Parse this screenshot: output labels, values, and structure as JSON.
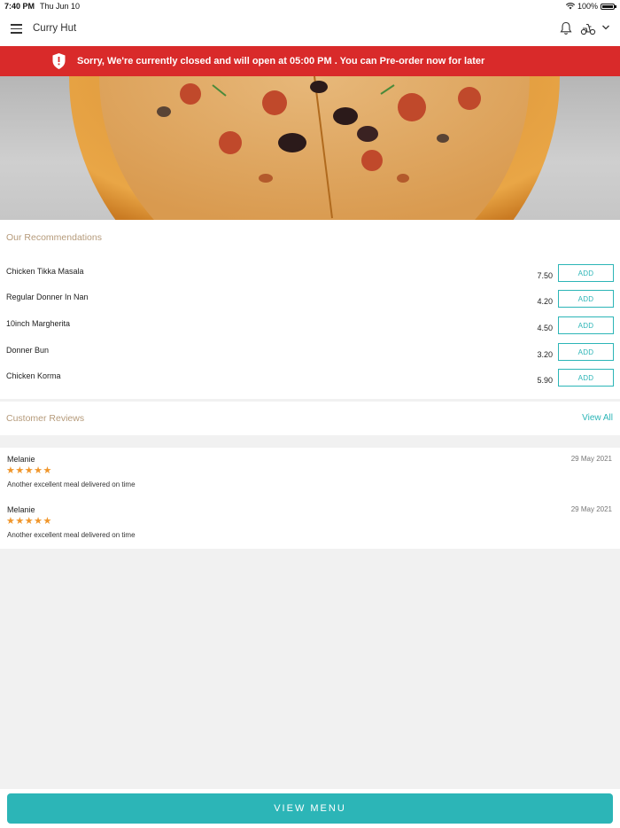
{
  "status_bar": {
    "time": "7:40 PM",
    "date": "Thu Jun 10",
    "battery": "100%"
  },
  "header": {
    "title": "Curry Hut"
  },
  "banner": {
    "text": "Sorry, We're currently closed and will open at 05:00 PM . You can Pre-order now for later"
  },
  "recommendations": {
    "title": "Our Recommendations",
    "add_label": "ADD",
    "items": [
      {
        "name": "Chicken Tikka Masala",
        "price": "7.50"
      },
      {
        "name": "Regular Donner In Nan",
        "price": "4.20"
      },
      {
        "name": "10inch Margherita",
        "price": "4.50"
      },
      {
        "name": "Donner Bun",
        "price": "3.20"
      },
      {
        "name": "Chicken Korma",
        "price": "5.90"
      }
    ]
  },
  "reviews": {
    "title": "Customer Reviews",
    "view_all": "View All",
    "items": [
      {
        "name": "Melanie",
        "date": "29 May 2021",
        "rating": 5,
        "stars": "★★★★★",
        "text": "Another excellent meal delivered on time"
      },
      {
        "name": "Melanie",
        "date": "29 May 2021",
        "rating": 5,
        "stars": "★★★★★",
        "text": "Another excellent meal delivered on time"
      }
    ]
  },
  "footer": {
    "view_menu": "VIEW MENU"
  },
  "colors": {
    "accent": "#2cb5b7",
    "banner": "#d92a2a",
    "section_title": "#b59a7a",
    "star": "#f0962b"
  }
}
